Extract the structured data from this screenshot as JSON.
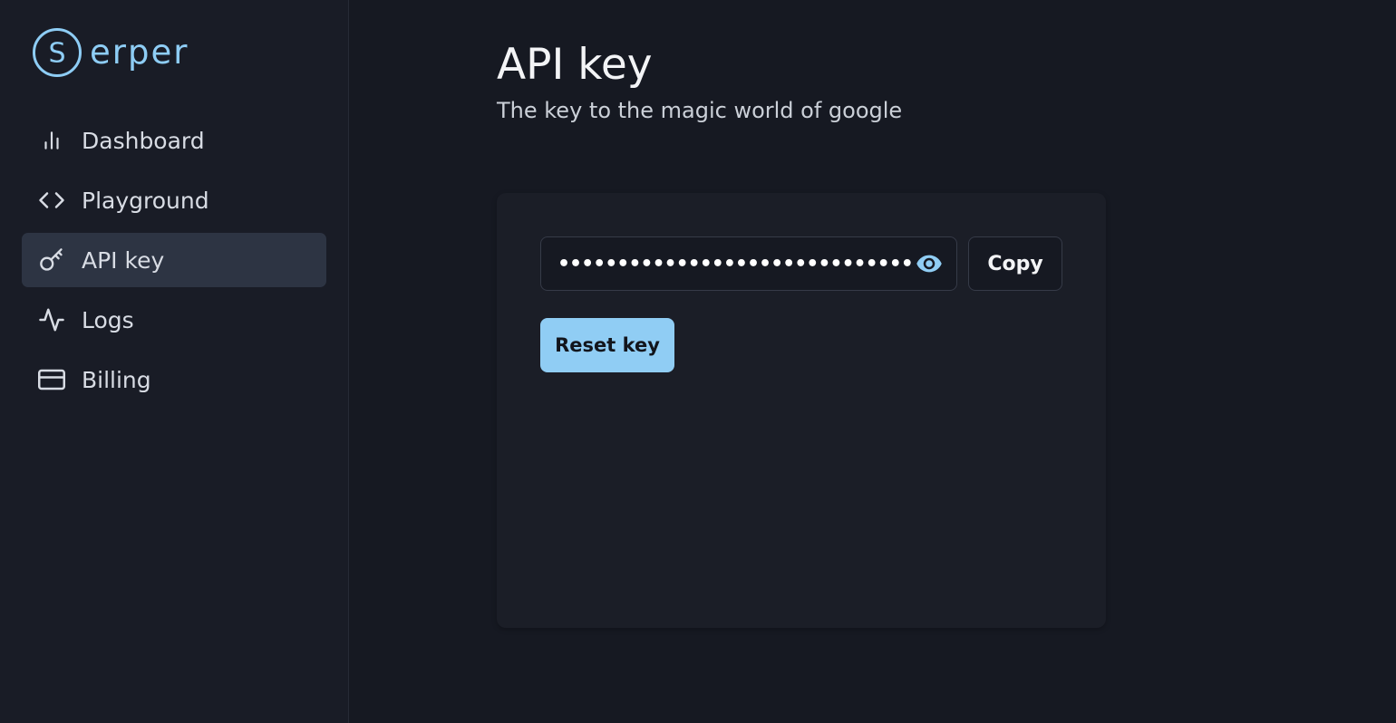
{
  "brand": {
    "name": "erper",
    "letter": "S",
    "color": "#8ecdf5"
  },
  "sidebar": {
    "items": [
      {
        "label": "Dashboard",
        "icon": "bar-chart-icon",
        "active": false
      },
      {
        "label": "Playground",
        "icon": "code-icon",
        "active": false
      },
      {
        "label": "API key",
        "icon": "key-icon",
        "active": true
      },
      {
        "label": "Logs",
        "icon": "activity-icon",
        "active": false
      },
      {
        "label": "Billing",
        "icon": "credit-card-icon",
        "active": false
      }
    ]
  },
  "main": {
    "title": "API key",
    "subtitle": "The key to the magic world of google",
    "key_field": {
      "masked_value": "••••••••••••••••••••••••••••••••••••",
      "toggle_icon": "eye-icon"
    },
    "copy_label": "Copy",
    "reset_label": "Reset key"
  },
  "colors": {
    "accent": "#90cdf4",
    "background": "#161922",
    "sidebar": "#191c26",
    "active_item": "#2d3443",
    "card": "#1b1e27"
  }
}
